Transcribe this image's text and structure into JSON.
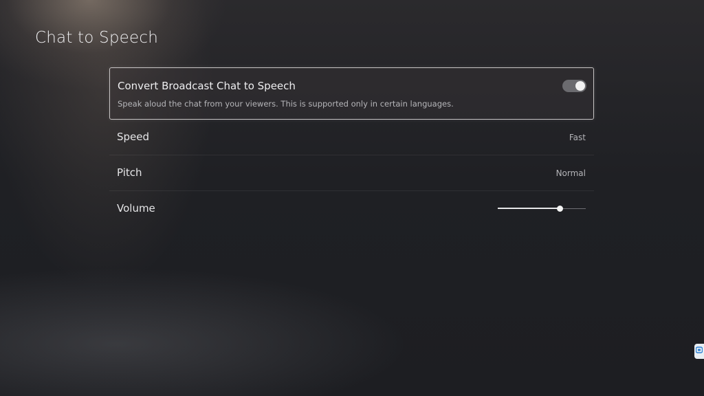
{
  "page": {
    "title": "Chat to Speech"
  },
  "settings": {
    "convert": {
      "label": "Convert Broadcast Chat to Speech",
      "description": "Speak aloud the chat from your viewers. This is supported only in certain languages.",
      "enabled": true
    },
    "speed": {
      "label": "Speed",
      "value": "Fast"
    },
    "pitch": {
      "label": "Pitch",
      "value": "Normal"
    },
    "volume": {
      "label": "Volume",
      "level": 0.7
    }
  },
  "side_badge": {
    "icon": "remote-control-icon",
    "color": "#2a7fd4"
  },
  "colors": {
    "background": "#1f2024",
    "focus_border": "#c9c6c6",
    "toggle_on_track": "#6b6b6f"
  }
}
